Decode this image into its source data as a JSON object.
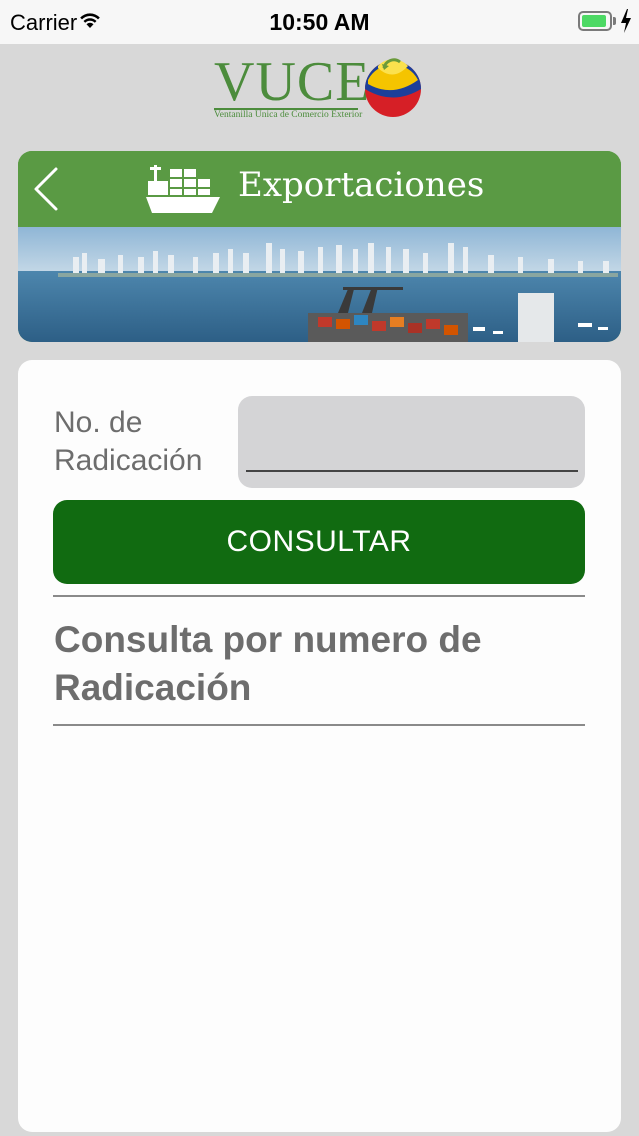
{
  "status_bar": {
    "carrier": "Carrier",
    "time": "10:50 AM",
    "battery_color": "#4cd964"
  },
  "logo": {
    "text": "VUCE",
    "subtitle": "Ventanilla Única de Comercio Exterior",
    "brand_color": "#4c8c3c"
  },
  "header": {
    "title": "Exportaciones",
    "back_icon": "chevron-left-icon",
    "section_icon": "cargo-ship-icon",
    "bar_color": "#5a9a44"
  },
  "form": {
    "field_label": "No. de Radicación",
    "field_value": "",
    "field_placeholder": "",
    "button_label": "CONSULTAR",
    "button_color": "#116b11"
  },
  "section": {
    "title": "Consulta por numero de Radicación"
  }
}
